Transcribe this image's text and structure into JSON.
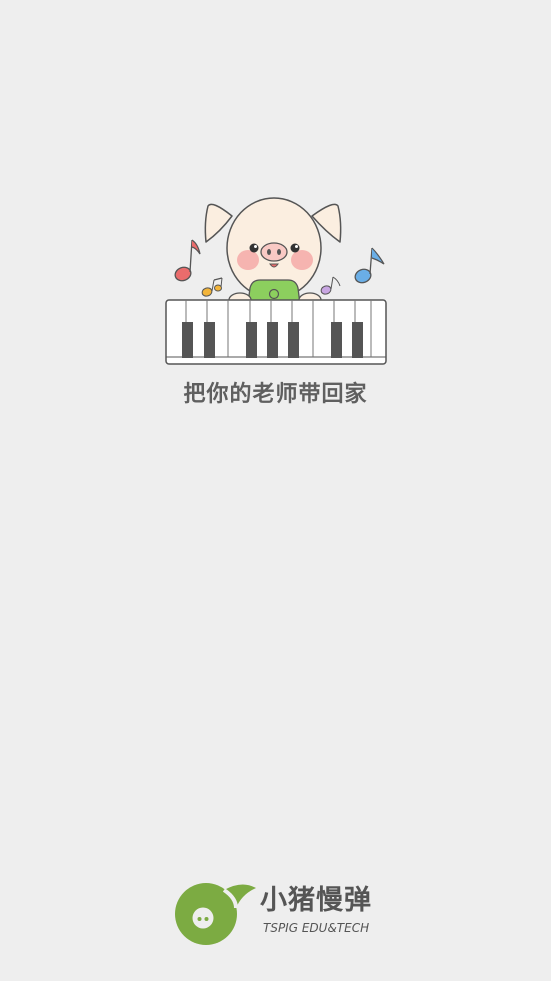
{
  "splash": {
    "slogan": "把你的老师带回家",
    "brand_name": "小猪慢弹",
    "brand_subtitle": "TSPIG EDU&TECH"
  },
  "colors": {
    "background": "#eeeeee",
    "brand_green": "#7cab42",
    "text_gray": "#5f5f5f",
    "pig_skin": "#fbeee0",
    "pig_cheek": "#f6b4b0",
    "pig_shirt": "#8ccf5e",
    "note_red": "#ea6c6c",
    "note_blue": "#6aaee6",
    "note_orange": "#f2b43a",
    "note_purple": "#c8a6e2",
    "piano_black": "#555555"
  },
  "icons": {
    "mascot": "pig-piano-icon",
    "logo": "note-logo-icon"
  }
}
